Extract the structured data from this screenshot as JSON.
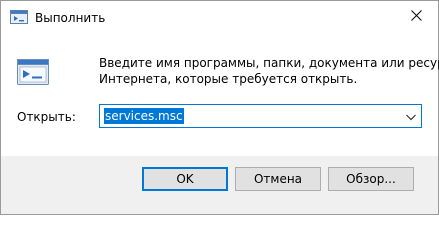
{
  "window": {
    "title": "Выполнить",
    "close_glyph": "✕"
  },
  "body": {
    "description_lines": [
      "Введите имя программы, папки, документа или ресурса",
      "Интернета, которые требуется открыть."
    ],
    "open_label": "Открыть:",
    "open_value": "services.msc"
  },
  "buttons": {
    "ok": "OK",
    "cancel": "Отмена",
    "browse": "Обзор..."
  },
  "colors": {
    "accent": "#0078d7",
    "footer_bg": "#f0f0f0",
    "button_bg": "#e1e1e1"
  },
  "icons": {
    "app": "run-app-icon",
    "run": "run-dialog-icon",
    "close": "close-icon",
    "dropdown": "chevron-down-icon"
  }
}
